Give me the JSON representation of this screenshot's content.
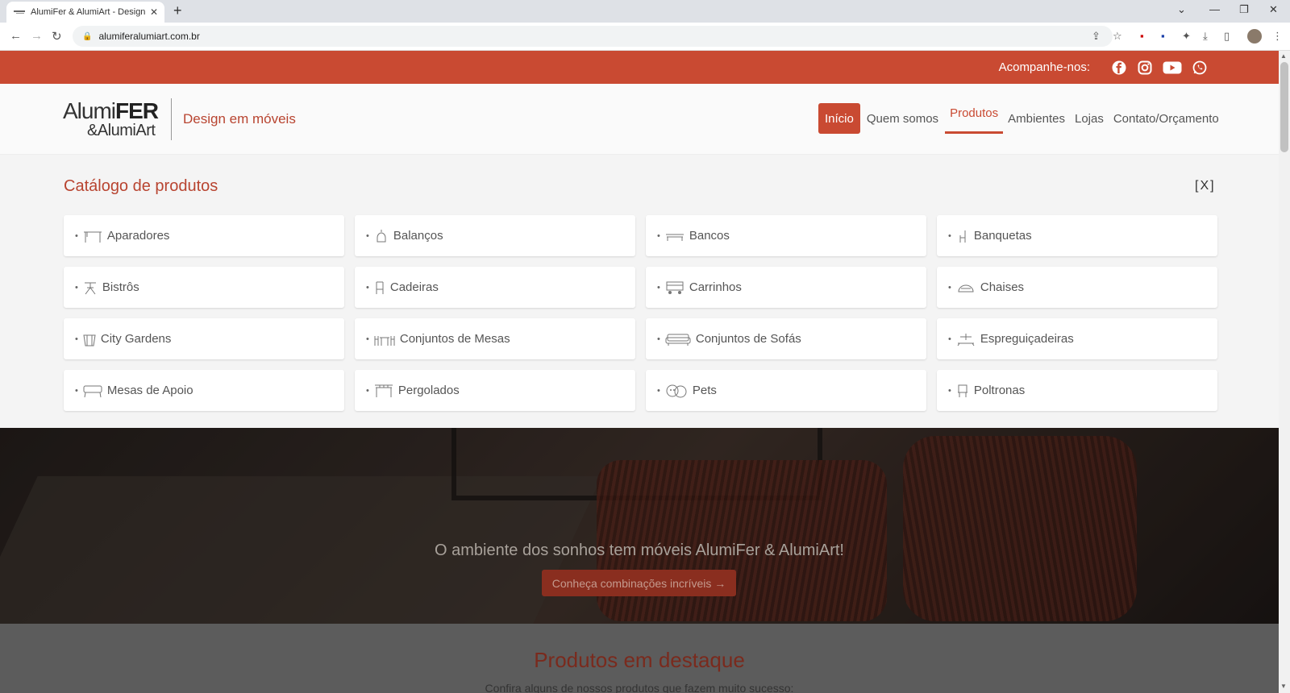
{
  "browser": {
    "tab_title": "AlumiFer & AlumiArt - Design em...",
    "url": "alumiferalumiart.com.br"
  },
  "topstrip": {
    "follow_label": "Acompanhe-nos:"
  },
  "header": {
    "logo_line1_a": "Alumi",
    "logo_line1_b": "FER",
    "logo_line2": "&AlumiArt",
    "tagline": "Design em móveis",
    "nav": [
      "Início",
      "Quem somos",
      "Produtos",
      "Ambientes",
      "Lojas",
      "Contato/Orçamento"
    ]
  },
  "catalog": {
    "title": "Catálogo de produtos",
    "close_label": "[X]",
    "items": [
      "Aparadores",
      "Balanços",
      "Bancos",
      "Banquetas",
      "Bistrôs",
      "Cadeiras",
      "Carrinhos",
      "Chaises",
      "City Gardens",
      "Conjuntos de Mesas",
      "Conjuntos de Sofás",
      "Espreguiçadeiras",
      "Mesas de Apoio",
      "Pergolados",
      "Pets",
      "Poltronas"
    ]
  },
  "hero": {
    "headline": "O ambiente dos sonhos tem móveis AlumiFer & AlumiArt!",
    "cta": "Conheça combinações incríveis →"
  },
  "featured": {
    "title": "Produtos em destaque",
    "subtitle": "Confira alguns de nossos produtos que fazem muito sucesso:"
  },
  "colors": {
    "brand": "#c94a32",
    "brand_dark": "#b84430"
  }
}
